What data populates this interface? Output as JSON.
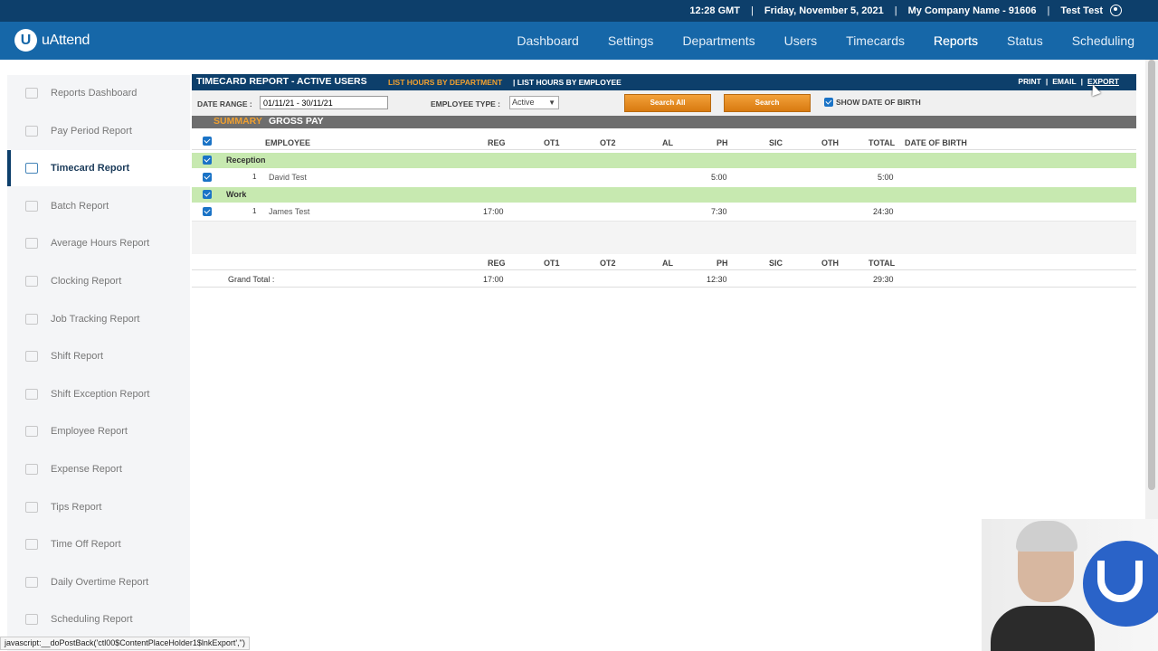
{
  "topbar": {
    "time": "12:28 GMT",
    "date": "Friday, November 5, 2021",
    "company": "My Company Name - 91606",
    "user": "Test Test"
  },
  "nav": {
    "logo_letter": "U",
    "logo_text": "uAttend",
    "items": [
      "Dashboard",
      "Settings",
      "Departments",
      "Users",
      "Timecards",
      "Reports",
      "Status",
      "Scheduling"
    ],
    "active": "Reports"
  },
  "sidebar": {
    "items": [
      {
        "label": "Reports Dashboard",
        "icon": "reports-dashboard-icon"
      },
      {
        "label": "Pay Period Report",
        "icon": "pay-period-icon"
      },
      {
        "label": "Timecard Report",
        "icon": "timecard-icon"
      },
      {
        "label": "Batch Report",
        "icon": "batch-icon"
      },
      {
        "label": "Average Hours Report",
        "icon": "bar-chart-icon"
      },
      {
        "label": "Clocking Report",
        "icon": "clock-icon"
      },
      {
        "label": "Job Tracking Report",
        "icon": "briefcase-icon"
      },
      {
        "label": "Shift Report",
        "icon": "calendar-icon"
      },
      {
        "label": "Shift Exception Report",
        "icon": "calendar-alert-icon"
      },
      {
        "label": "Employee Report",
        "icon": "people-icon"
      },
      {
        "label": "Expense Report",
        "icon": "expense-icon"
      },
      {
        "label": "Tips Report",
        "icon": "tips-icon"
      },
      {
        "label": "Time Off Report",
        "icon": "time-off-icon"
      },
      {
        "label": "Daily Overtime Report",
        "icon": "overtime-icon"
      },
      {
        "label": "Scheduling Report",
        "icon": "schedule-icon"
      }
    ],
    "active_index": 2
  },
  "report": {
    "title": "TIMECARD REPORT - ACTIVE USERS",
    "link_dept": "LIST HOURS BY DEPARTMENT",
    "link_emp": "| LIST HOURS BY EMPLOYEE",
    "print": "PRINT",
    "email": "EMAIL",
    "export": "EXPORT",
    "date_range_label": "DATE RANGE :",
    "date_range_value": "01/11/21 - 30/11/21",
    "employee_type_label": "EMPLOYEE TYPE :",
    "employee_type_value": "Active",
    "search_all": "Search All",
    "search": "Search",
    "show_dob": "SHOW DATE OF BIRTH",
    "tab_summary": "SUMMARY",
    "tab_gross": "GROSS PAY"
  },
  "table": {
    "columns": [
      "EMPLOYEE",
      "REG",
      "OT1",
      "OT2",
      "AL",
      "PH",
      "SIC",
      "OTH",
      "TOTAL",
      "DATE OF BIRTH"
    ],
    "groups": [
      {
        "name": "Reception",
        "rows": [
          {
            "num": "1",
            "employee": "David Test",
            "reg": "",
            "ph": "5:00",
            "total": "5:00"
          }
        ]
      },
      {
        "name": "Work",
        "rows": [
          {
            "num": "1",
            "employee": "James Test",
            "reg": "17:00",
            "ph": "7:30",
            "total": "24:30"
          }
        ]
      }
    ],
    "total_columns": [
      "REG",
      "OT1",
      "OT2",
      "AL",
      "PH",
      "SIC",
      "OTH",
      "TOTAL"
    ],
    "grand_total_label": "Grand Total :",
    "grand_total": {
      "reg": "17:00",
      "ph": "12:30",
      "total": "29:30"
    }
  },
  "status_bar": "javascript:__doPostBack('ctl00$ContentPlaceHolder1$lnkExport','')"
}
